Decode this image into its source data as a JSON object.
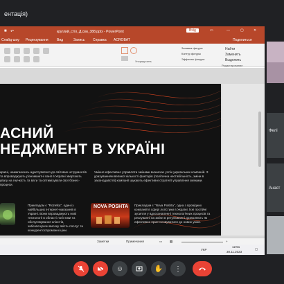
{
  "meet": {
    "title": "ентація)"
  },
  "ppt": {
    "filename": "круглий_стіл_Д.сви_388.pptx - PowerPoint",
    "sign_in": "Вхід",
    "tabs": [
      "Слайд-шоу",
      "Рецензування",
      "Вид",
      "Запись",
      "Справка",
      "ACROBAT"
    ],
    "share": "Поделиться",
    "groups": [
      "Упорядочить",
      "Редактирование"
    ],
    "ribbon_right": [
      "Найти",
      "Заменить",
      "Выделить"
    ],
    "ribbon_shape_fx": [
      "Заливка фигуры",
      "Контур фигуры",
      "Эффекты фигуры"
    ]
  },
  "slide": {
    "heading_line1": "АСНИЙ",
    "heading_line2": "НЕДЖМЕНТ В УКРАЇНІ",
    "left_text": "країні, намагаючись адаптуватися до світових нструментів та впроваджують різноманітні панії в Україні звертають увагу на гнучкість та вати та оптимізувати свої бізнес-процеси.",
    "mid_text": "Уміння ефективно управляти змінами визначає успіх українських компаній. З урахуванням великої кількості факторів (політична нестабільність, зміни в законодавстві) компанії шукають ефективні стратегії управління змінами.",
    "rozetka_text": "Прикладом є \"Rozetka\", один із найбільших інтернет-магазинів в Україні. Вони впроваджують нові технології в області логістики та обслуговування клієнтів, забезпечуючи високу якість послуг та конкурентоспроможні ціни.",
    "nova_logo": "NOVA POSHTA",
    "nova_text": "Прикладом є \"Nova Poshta\", одна з провідних компаній в сфері логістики в Україні. Їхні постійні зусилля у вдосконаленні технологічних процесів та реагуванні на зміни в регулюванні дозволяють їм ефективно пристосовуватися до нових умов."
  },
  "status": {
    "notes": "Заметки",
    "comments": "Примечания",
    "zoom": "+"
  },
  "taskbar": {
    "lang": "УКР",
    "time": "12:51",
    "date": "30.11.2023"
  },
  "participants": [
    {
      "label": ""
    },
    {
      "label": "Фелі"
    },
    {
      "label": "Анаст"
    },
    {
      "label": ""
    }
  ],
  "colors": {
    "ppt_red": "#b7472a",
    "end_call": "#ea4335"
  }
}
